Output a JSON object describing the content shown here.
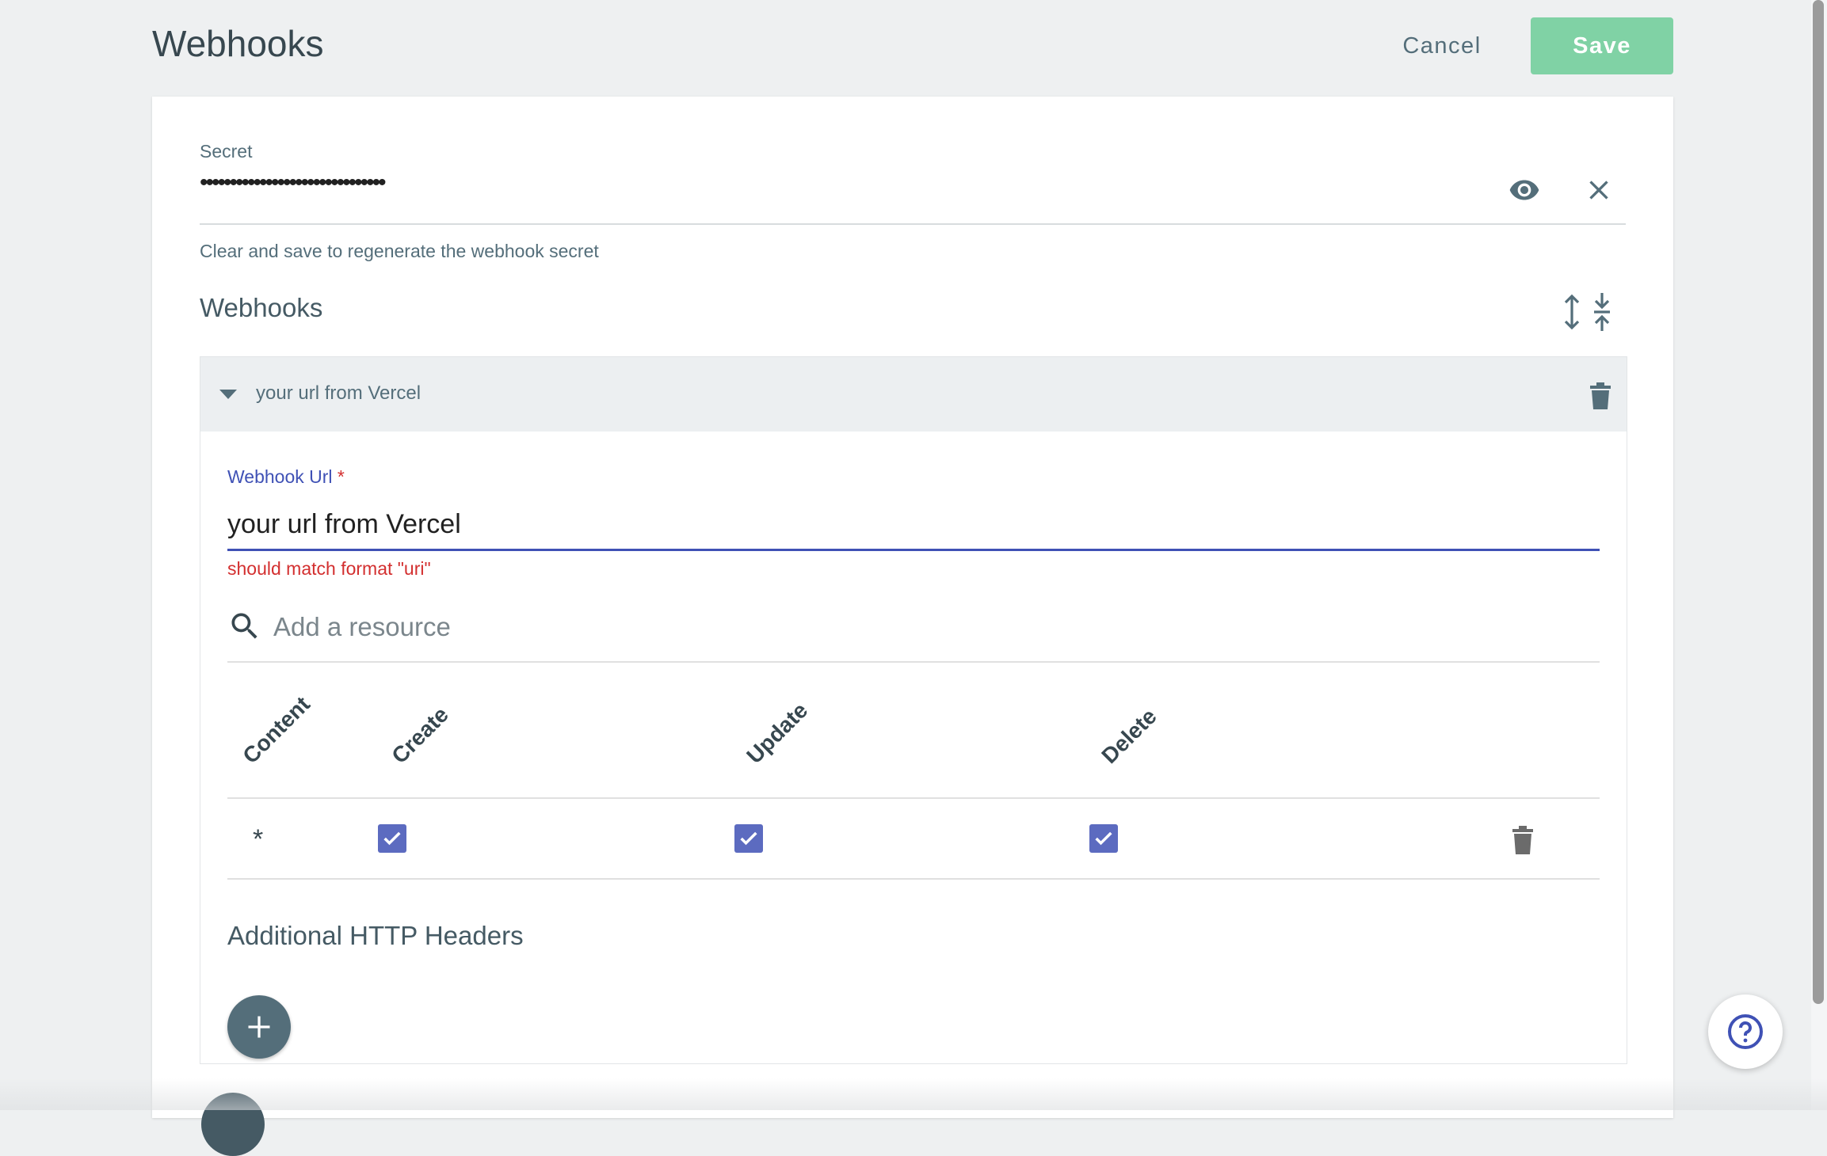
{
  "header": {
    "title": "Webhooks",
    "cancel_label": "Cancel",
    "save_label": "Save",
    "save_color": "#80d2a5"
  },
  "secret": {
    "label": "Secret",
    "masked_value": "•••••••••••••••••••••••••••••••",
    "helper": "Clear and save to regenerate the webhook secret",
    "icons": [
      "eye-icon",
      "close-icon"
    ]
  },
  "webhooks_section": {
    "title": "Webhooks",
    "icons": [
      "expand-all-icon",
      "collapse-all-icon"
    ]
  },
  "webhook_item": {
    "header_title": "your url from Vercel",
    "url_label": "Webhook Url",
    "required_mark": "*",
    "url_value": "your url from Vercel",
    "error": "should match format \"uri\"",
    "resource_placeholder": "Add a resource",
    "table": {
      "columns": [
        "Content",
        "Create",
        "Update",
        "Delete"
      ],
      "rows": [
        {
          "content": "*",
          "create": true,
          "update": true,
          "delete": true
        }
      ]
    },
    "headers_title": "Additional HTTP Headers"
  },
  "colors": {
    "accent": "#3f51b5",
    "checkbox": "#5c6bc0",
    "error": "#d32f2f",
    "fab": "#546e7a"
  }
}
